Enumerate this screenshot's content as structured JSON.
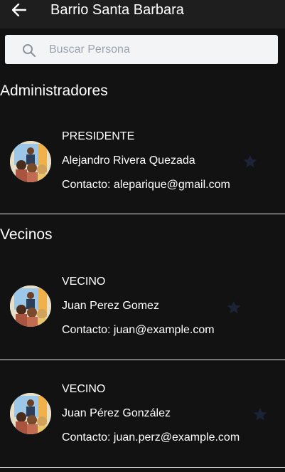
{
  "header": {
    "title": "Barrio Santa Barbara",
    "back_icon": "arrow-left-icon"
  },
  "search": {
    "placeholder": "Buscar Persona",
    "value": ""
  },
  "sections": {
    "admins": {
      "title": "Administradores"
    },
    "neighbors": {
      "title": "Vecinos"
    }
  },
  "people": [
    {
      "role": "PRESIDENTE",
      "name": "Alejandro Rivera Quezada",
      "contact": "Contacto: aleparique@gmail.com"
    },
    {
      "role": "VECINO",
      "name": "Juan Perez Gomez",
      "contact": "Contacto: juan@example.com"
    },
    {
      "role": "VECINO",
      "name": "Juan Pérez González",
      "contact": "Contacto: juan.perz@example.com"
    }
  ],
  "colors": {
    "background": "#121212",
    "appbar": "#1e1e1e",
    "search_bg": "#f3f4f6",
    "star": "#1a2436"
  }
}
